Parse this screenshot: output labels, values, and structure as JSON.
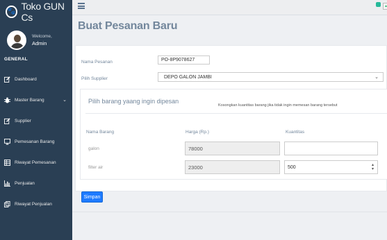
{
  "app": {
    "brand_name": "Toko GUN Cs",
    "brand_icon": "paw-icon"
  },
  "profile": {
    "welcome": "Welcome,",
    "name": "Admin"
  },
  "sidebar": {
    "section_title": "GENERAL",
    "items": [
      {
        "label": "Dashboard",
        "icon": "edit-icon"
      },
      {
        "label": "Master Barang",
        "icon": "bug-icon",
        "has_submenu": true
      },
      {
        "label": "Supplier",
        "icon": "edit-icon"
      },
      {
        "label": "Pemesanan Barang",
        "icon": "desktop-icon"
      },
      {
        "label": "Riwayat Pemesanan",
        "icon": "table-icon"
      },
      {
        "label": "Penjualan",
        "icon": "bar-chart-icon"
      },
      {
        "label": "Riwayat Penjualan",
        "icon": "clone-icon"
      }
    ]
  },
  "topbar": {
    "menu_icon": "hamburger-icon"
  },
  "page": {
    "title": "Buat Pesanan Baru"
  },
  "form": {
    "order_name_label": "Nama Pesanan",
    "order_name_value": "PO-8P9078627",
    "supplier_label": "Pilih Supplier",
    "supplier_value": "DEPO GALON JAMBI"
  },
  "items_panel": {
    "title": "Pilih barang yaang ingin dipesan",
    "hint": "Kosongkan kuantitas barang jika tidak ingin memesan barang tersebut",
    "columns": [
      "Nama Barang",
      "Harga (Rp.)",
      "Kuantitas"
    ],
    "rows": [
      {
        "name": "galon",
        "price": "78000",
        "qty": ""
      },
      {
        "name": "filter air",
        "price": "23000",
        "qty": "500"
      }
    ]
  },
  "actions": {
    "save_label": "Simpan"
  },
  "colors": {
    "sidebar_bg": "#2a3f54",
    "primary_button": "#1e7bff",
    "notification_badge": "#26b99a"
  }
}
